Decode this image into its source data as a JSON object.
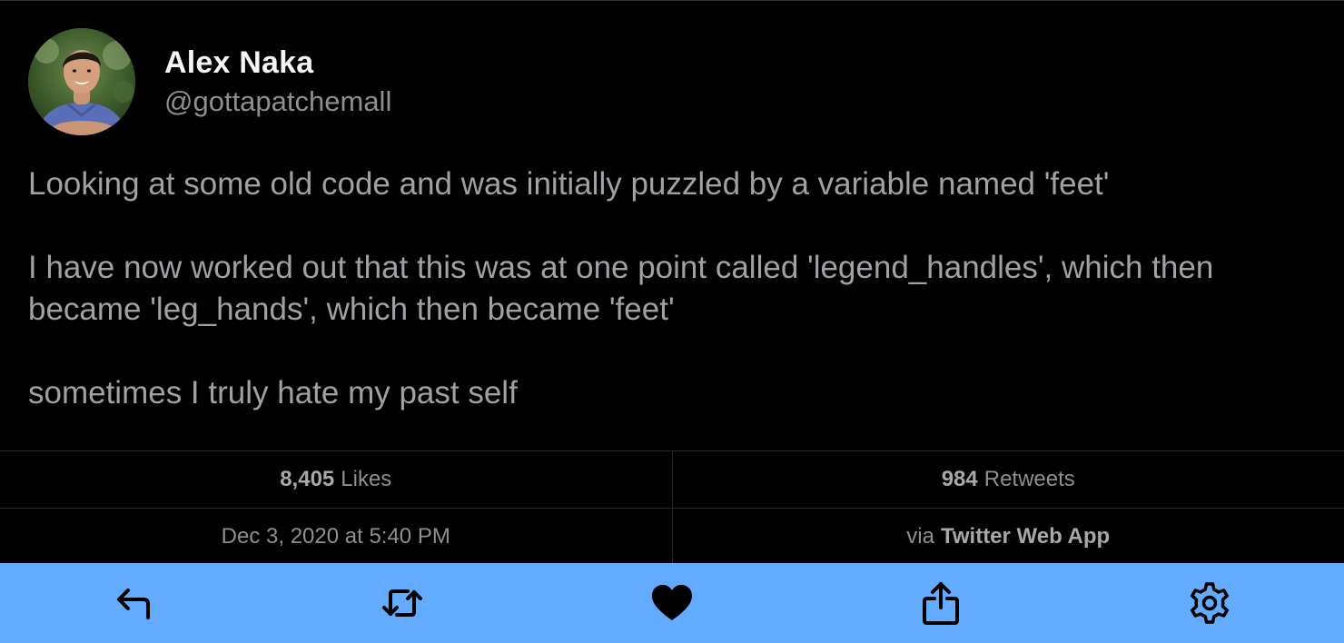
{
  "author": {
    "display_name": "Alex Naka",
    "handle": "@gottapatchemall",
    "avatar_icon": "profile-photo"
  },
  "tweet": {
    "paragraphs": [
      "Looking at some old code and was initially puzzled by a variable named 'feet'",
      "I have now worked out that this was at one point called 'legend_handles', which then became 'leg_hands', which then became 'feet'",
      "sometimes I truly hate my past self"
    ]
  },
  "stats": {
    "likes_count": "8,405",
    "likes_label": "Likes",
    "retweets_count": "984",
    "retweets_label": "Retweets",
    "timestamp": "Dec 3, 2020 at 5:40 PM",
    "via_prefix": "via",
    "via_app": "Twitter Web App"
  },
  "toolbar": {
    "background": "#62abff",
    "icon_color": "#000000",
    "items": [
      {
        "icon": "reply-icon"
      },
      {
        "icon": "retweet-icon"
      },
      {
        "icon": "heart-icon"
      },
      {
        "icon": "share-icon"
      },
      {
        "icon": "gear-icon"
      }
    ]
  },
  "colors": {
    "background": "#000000",
    "name_text": "#f5f5f5",
    "secondary_text": "#8e8e93",
    "body_text": "#a0a0a5",
    "accent": "#62abff"
  }
}
